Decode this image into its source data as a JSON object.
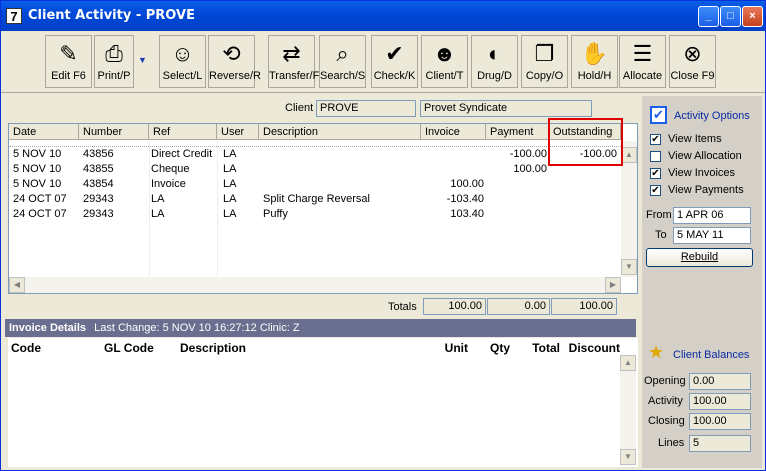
{
  "window": {
    "app_icon": "7",
    "title": "Client Activity - PROVE"
  },
  "toolbar": [
    {
      "label": "Edit F6",
      "icon": "edit-icon",
      "glyph": "✎"
    },
    {
      "label": "Print/P",
      "icon": "printer-icon",
      "glyph": "⎙"
    },
    {
      "label": "Select/L",
      "icon": "person-icon",
      "glyph": "☺"
    },
    {
      "label": "Reverse/R",
      "icon": "reverse-icon",
      "glyph": "⟲"
    },
    {
      "label": "Transfer/F",
      "icon": "transfer-icon",
      "glyph": "⇄"
    },
    {
      "label": "Search/S",
      "icon": "search-icon",
      "glyph": "⌕"
    },
    {
      "label": "Check/K",
      "icon": "check-icon",
      "glyph": "✔"
    },
    {
      "label": "Client/T",
      "icon": "client-icon",
      "glyph": "☻"
    },
    {
      "label": "Drug/D",
      "icon": "drug-icon",
      "glyph": "◐"
    },
    {
      "label": "Copy/O",
      "icon": "copy-icon",
      "glyph": "❐"
    },
    {
      "label": "Hold/H",
      "icon": "hold-icon",
      "glyph": "✋"
    },
    {
      "label": "Allocate",
      "icon": "allocate-icon",
      "glyph": "☰"
    },
    {
      "label": "Close F9",
      "icon": "close-icon",
      "glyph": "⊗"
    }
  ],
  "client": {
    "label": "Client",
    "code": "PROVE",
    "name": "Provet Syndicate"
  },
  "activity": {
    "columns": [
      "Date",
      "Number",
      "Ref",
      "User",
      "Description",
      "Invoice",
      "Payment",
      "Outstanding"
    ],
    "rows": [
      [
        "5 NOV 10",
        "43856",
        "Direct Credit",
        "LA",
        "",
        "",
        "-100.00",
        "-100.00"
      ],
      [
        "5 NOV 10",
        "43855",
        "Cheque",
        "LA",
        "",
        "",
        "100.00",
        ""
      ],
      [
        "5 NOV 10",
        "43854",
        "Invoice",
        "LA",
        "",
        "100.00",
        "",
        ""
      ],
      [
        "24 OCT 07",
        "29343",
        "LA",
        "LA",
        "Split Charge Reversal",
        "-103.40",
        "",
        ""
      ],
      [
        "24 OCT 07",
        "29343",
        "LA",
        "LA",
        "Puffy",
        "103.40",
        "",
        ""
      ]
    ],
    "totals_label": "Totals",
    "totals": {
      "invoice": "100.00",
      "payment": "0.00",
      "outstanding": "100.00"
    }
  },
  "invoice_details": {
    "header": "Invoice Details",
    "last_change": "Last Change: 5 NOV 10  16:27:12  Clinic: Z",
    "columns": [
      "Code",
      "GL Code",
      "Description",
      "Unit",
      "Qty",
      "Total",
      "Discount"
    ]
  },
  "activity_options": {
    "title": "Activity Options",
    "options": [
      {
        "label": "View Items",
        "checked": true
      },
      {
        "label": "View Allocation",
        "checked": false
      },
      {
        "label": "View Invoices",
        "checked": true
      },
      {
        "label": "View Payments",
        "checked": true
      }
    ],
    "from_label": "From",
    "from_value": "1 APR 06",
    "to_label": "To",
    "to_value": "5 MAY 11",
    "rebuild_label": "Rebuild"
  },
  "client_balances": {
    "title": "Client Balances",
    "opening_label": "Opening",
    "opening": "0.00",
    "activity_label": "Activity",
    "activity": "100.00",
    "closing_label": "Closing",
    "closing": "100.00",
    "lines_label": "Lines",
    "lines": "5"
  },
  "colors": {
    "title_bar": "#0048d8",
    "highlight": "#e00000",
    "detail_bar": "#6b6f8f"
  }
}
